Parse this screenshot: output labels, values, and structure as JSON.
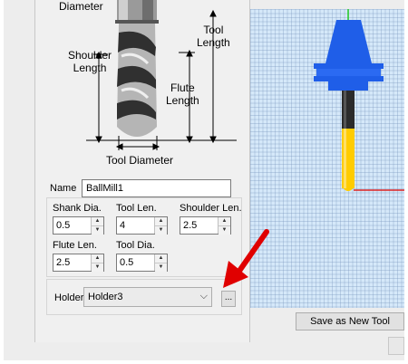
{
  "diagram": {
    "diameter_label": "Diameter",
    "shoulder_length_label": "Shoulder\nLength",
    "tool_length_label": "Tool\nLength",
    "flute_length_label": "Flute\nLength",
    "tool_diameter_label": "Tool Diameter"
  },
  "name": {
    "label": "Name",
    "value": "BallMill1"
  },
  "params": {
    "shank_dia": {
      "label": "Shank Dia.",
      "value": "0.5"
    },
    "tool_len": {
      "label": "Tool Len.",
      "value": "4"
    },
    "shoulder_len": {
      "label": "Shoulder Len.",
      "value": "2.5"
    },
    "flute_len": {
      "label": "Flute Len.",
      "value": "2.5"
    },
    "tool_dia": {
      "label": "Tool Dia.",
      "value": "0.5"
    }
  },
  "holder": {
    "label": "Holder",
    "value": "Holder3",
    "browse_label": "..."
  },
  "actions": {
    "save_new_label": "Save as New Tool"
  },
  "colors": {
    "holder_blue": "#1f5ee8",
    "tool_yellow": "#ffcc00",
    "grid_bg": "#d5e8f9",
    "arrow_red": "#e00000"
  },
  "icons": {
    "spin_up": "▲",
    "spin_down": "▼",
    "dropdown": "chevron-down-icon"
  }
}
